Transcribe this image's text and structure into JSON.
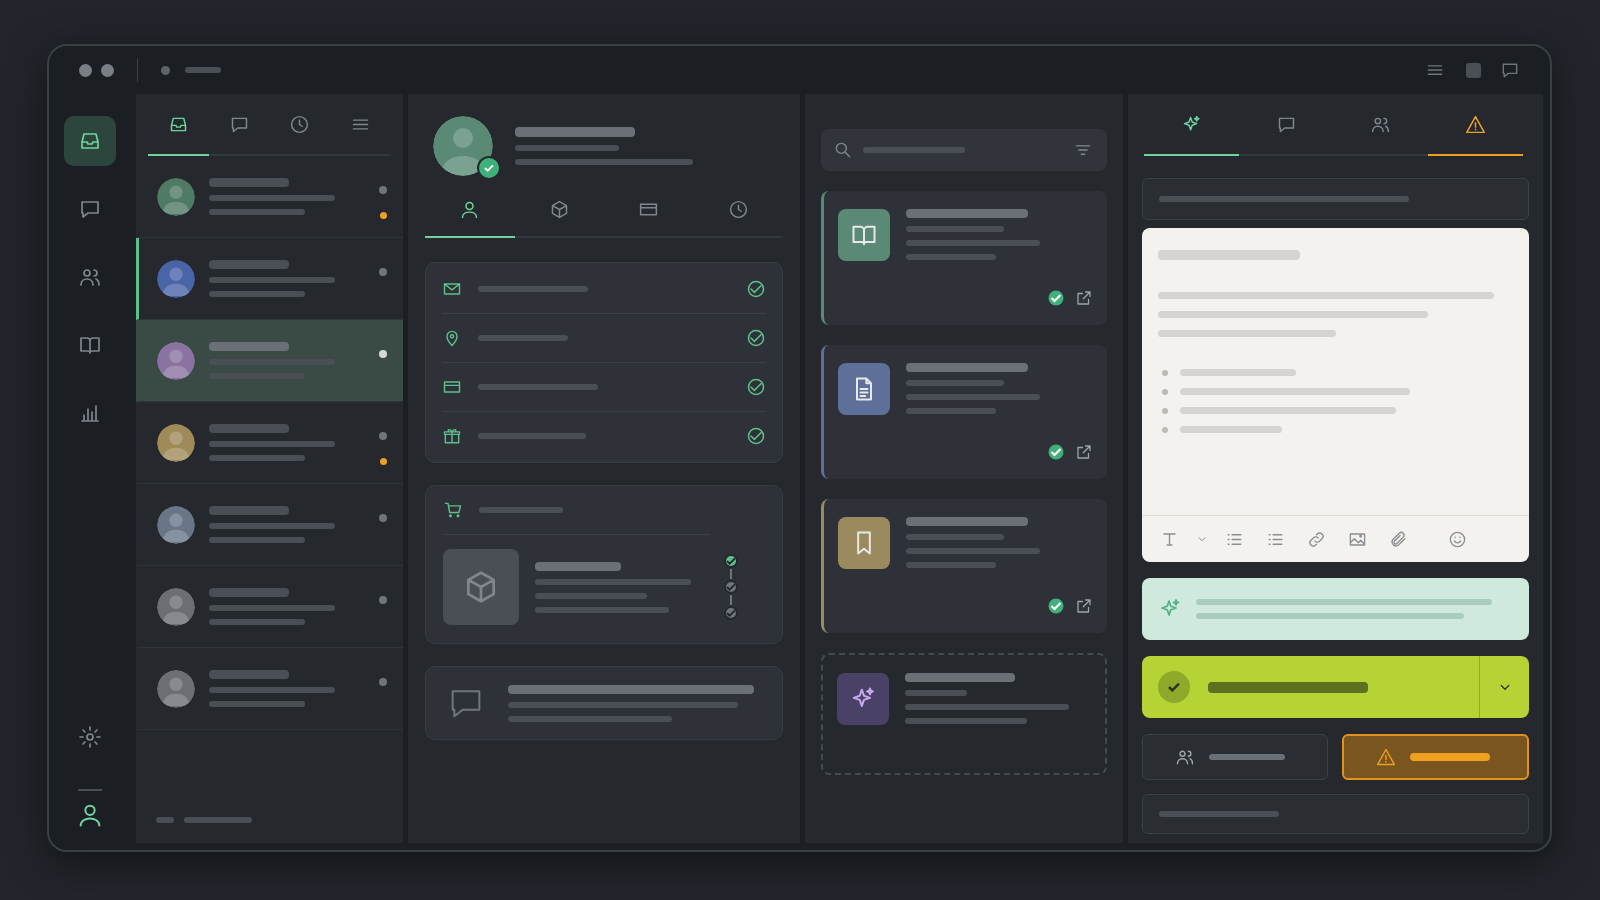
{
  "nav_rail": {
    "items": [
      {
        "selected": true
      },
      {
        "selected": false
      },
      {
        "selected": false
      },
      {
        "selected": false
      },
      {
        "selected": false
      }
    ],
    "account": {
      "selected": true
    }
  },
  "conversation_list": {
    "tabs": [
      {
        "selected": true
      },
      {
        "selected": false
      },
      {
        "selected": false
      },
      {
        "selected": false
      }
    ],
    "items": [
      {
        "color": "#4f7a66",
        "selected": false,
        "active": false,
        "unread": true
      },
      {
        "color": "#4a64a8",
        "selected": false,
        "active": true,
        "unread": false
      },
      {
        "color": "#8a73a0",
        "selected": true,
        "active": false,
        "unread": false
      },
      {
        "color": "#a08a5a",
        "selected": false,
        "active": false,
        "unread": true
      },
      {
        "color": "#6a7688",
        "selected": false,
        "active": false,
        "unread": false
      },
      {
        "color": "#6b6e72",
        "selected": false,
        "active": false,
        "unread": false
      },
      {
        "color": "#6b6e72",
        "selected": false,
        "active": false,
        "unread": false
      }
    ]
  },
  "contact": {
    "verified": true,
    "tabs": [
      {
        "selected": true
      },
      {
        "selected": false
      },
      {
        "selected": false
      },
      {
        "selected": false
      }
    ],
    "details": [
      {
        "verified": true
      },
      {
        "verified": true
      },
      {
        "verified": true
      },
      {
        "verified": true
      }
    ],
    "order": {
      "steps": [
        {
          "done": true
        },
        {
          "done": false
        },
        {
          "done": false
        }
      ]
    }
  },
  "results": {
    "cards": [
      {
        "color": "#5a8a76",
        "verified": true
      },
      {
        "color": "#5e6f99",
        "verified": true
      },
      {
        "color": "#9a8a5e",
        "verified": true
      }
    ]
  },
  "composer": {
    "tabs": [
      {
        "selected": true,
        "alert": false
      },
      {
        "selected": false,
        "alert": false
      },
      {
        "selected": false,
        "alert": false
      },
      {
        "selected": false,
        "alert": true
      }
    ]
  }
}
